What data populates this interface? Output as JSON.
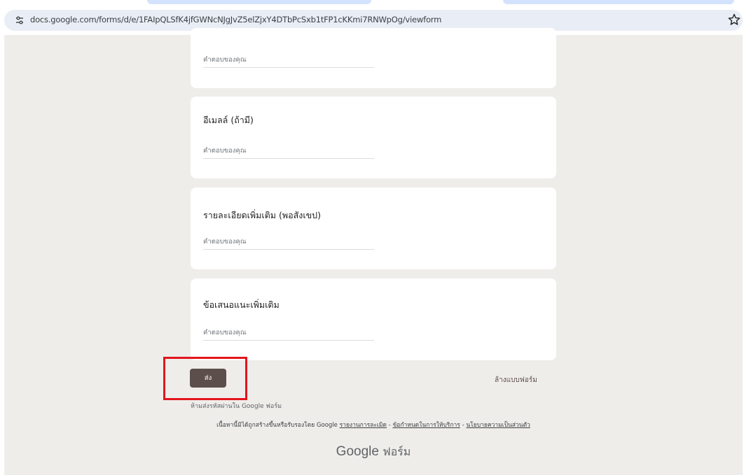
{
  "browser": {
    "url": "docs.google.com/forms/d/e/1FAIpQLSfK4jfGWNcNJgJvZ5elZjxY4DTbPcSxb1tFP1cKKmi7RNWpOg/viewform"
  },
  "form": {
    "answer_placeholder": "คำตอบของคุณ",
    "questions": [
      {
        "title": ""
      },
      {
        "title": "อีเมลล์ (ถ้ามี)"
      },
      {
        "title": "รายละเอียดเพิ่มเติม (พอสังเขป)"
      },
      {
        "title": "ข้อเสนอแนะเพิ่มเติม"
      }
    ],
    "submit_label": "ส่ง",
    "clear_label": "ล้างแบบฟอร์ม",
    "password_warning": "ห้ามส่งรหัสผ่านใน Google ฟอร์ม"
  },
  "footer": {
    "disclaimer": "เนื้อหานี้มิได้ถูกสร้างขึ้นหรือรับรองโดย Google",
    "report_abuse": "รายงานการละเมิด",
    "separator": "-",
    "terms": "ข้อกำหนดในการให้บริการ",
    "privacy": "นโยบายความเป็นส่วนตัว",
    "brand_google": "Google",
    "brand_forms": "ฟอร์ม"
  },
  "colors": {
    "page_background": "#efedea",
    "submit_button": "#5c4e4a",
    "highlight": "#e3151d"
  }
}
